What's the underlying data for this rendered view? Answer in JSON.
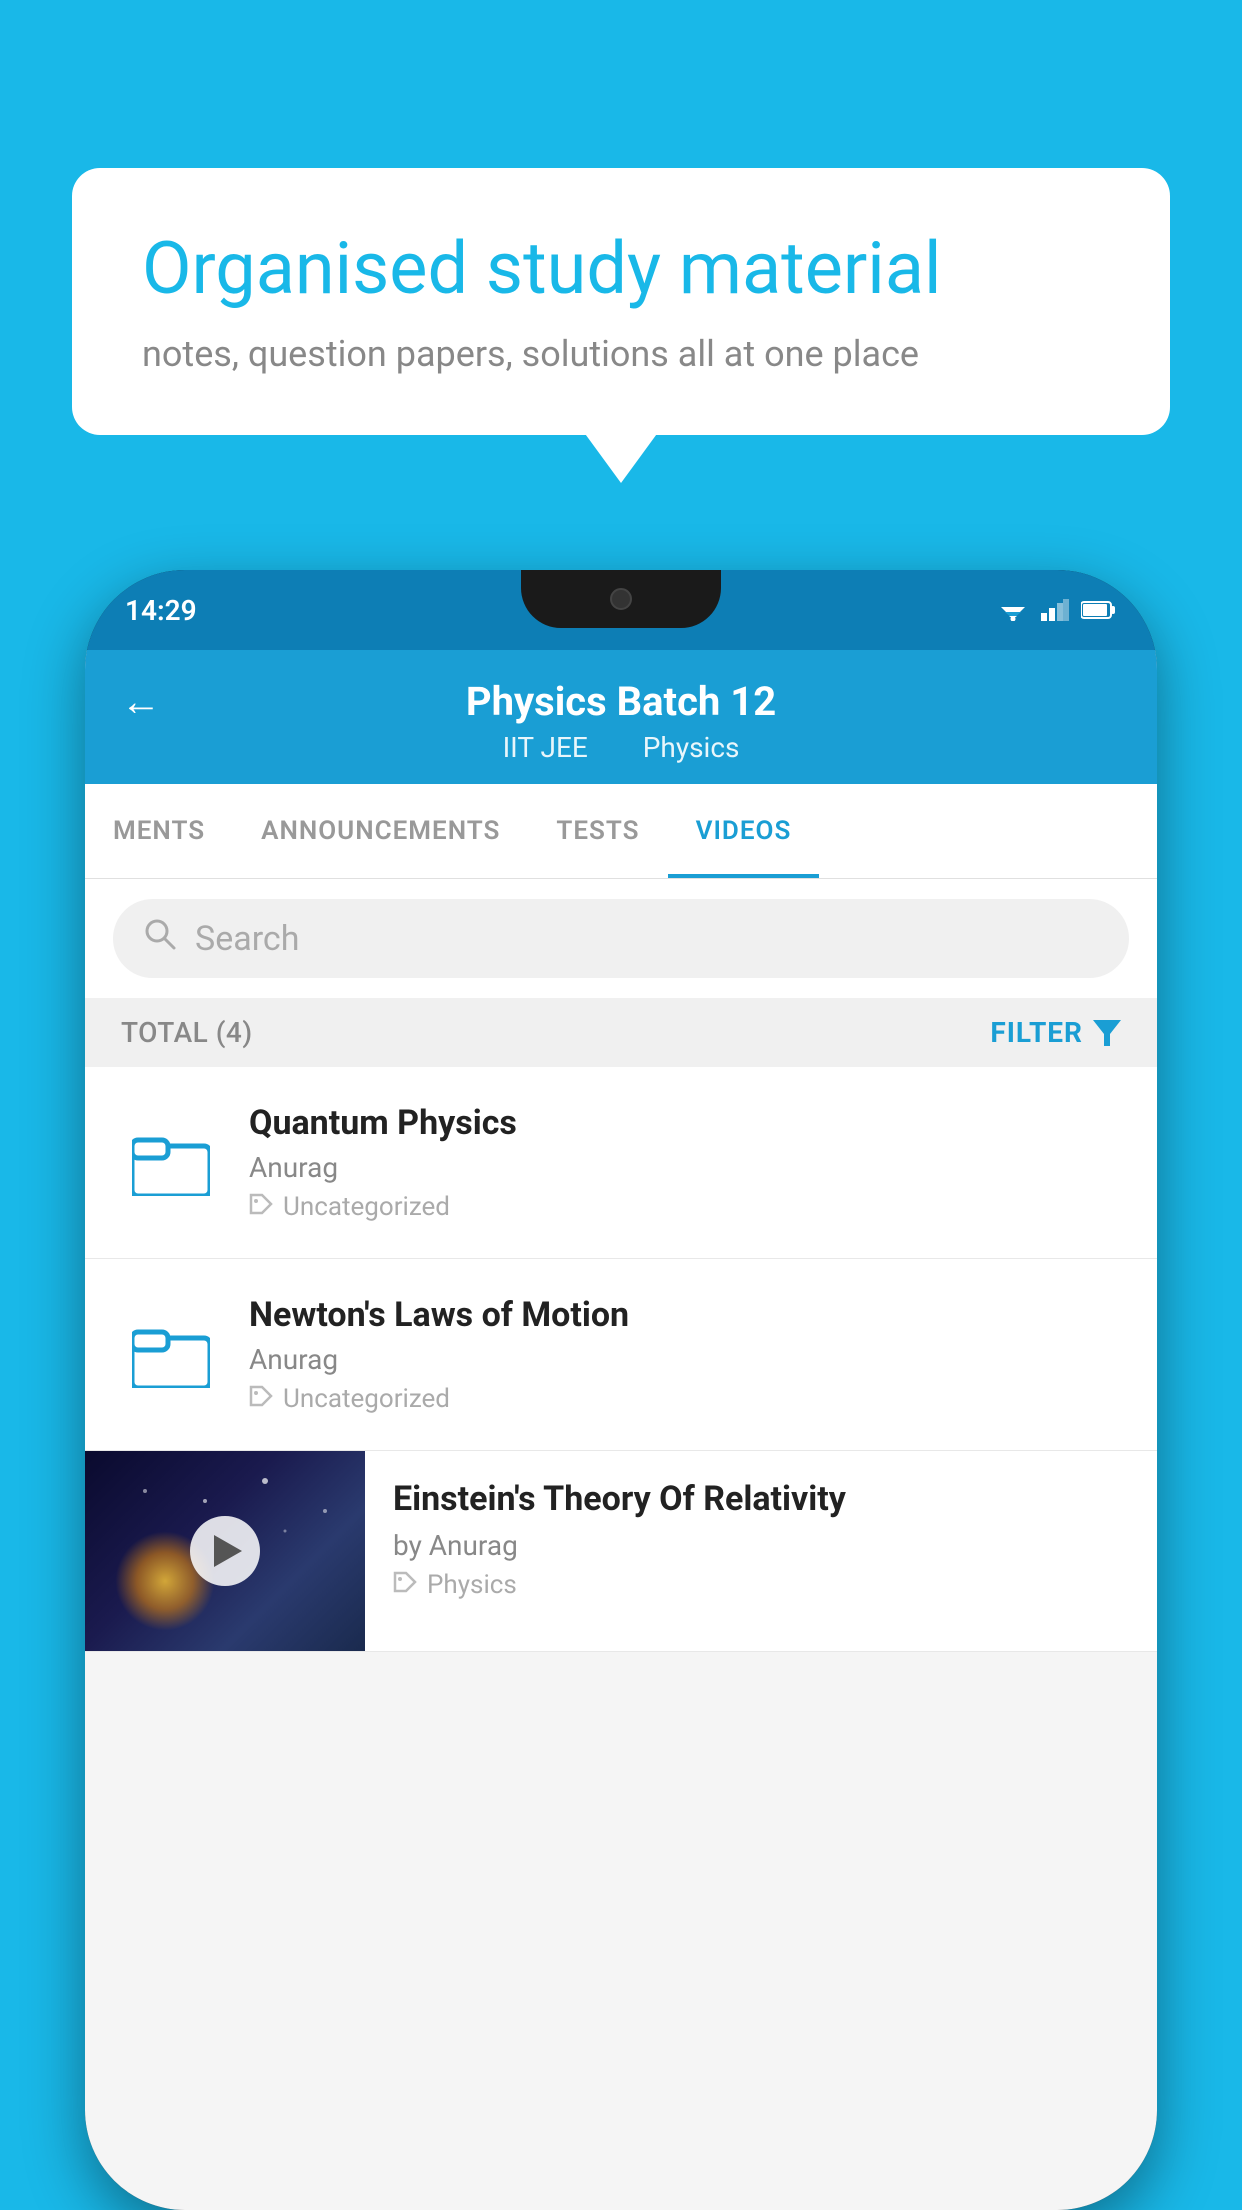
{
  "background_color": "#19b8e8",
  "speech_bubble": {
    "title": "Organised study material",
    "subtitle": "notes, question papers, solutions all at one place"
  },
  "phone": {
    "status_bar": {
      "time": "14:29"
    },
    "app_header": {
      "back_label": "←",
      "title": "Physics Batch 12",
      "subtitle_part1": "IIT JEE",
      "subtitle_part2": "Physics"
    },
    "tabs": [
      {
        "label": "MENTS",
        "active": false
      },
      {
        "label": "ANNOUNCEMENTS",
        "active": false
      },
      {
        "label": "TESTS",
        "active": false
      },
      {
        "label": "VIDEOS",
        "active": true
      }
    ],
    "search": {
      "placeholder": "Search"
    },
    "filter_bar": {
      "total_label": "TOTAL (4)",
      "filter_label": "FILTER"
    },
    "video_list": [
      {
        "id": 1,
        "title": "Quantum Physics",
        "author": "Anurag",
        "tag": "Uncategorized",
        "has_thumb": false
      },
      {
        "id": 2,
        "title": "Newton's Laws of Motion",
        "author": "Anurag",
        "tag": "Uncategorized",
        "has_thumb": false
      },
      {
        "id": 3,
        "title": "Einstein's Theory Of Relativity",
        "author": "by Anurag",
        "tag": "Physics",
        "has_thumb": true
      }
    ]
  }
}
